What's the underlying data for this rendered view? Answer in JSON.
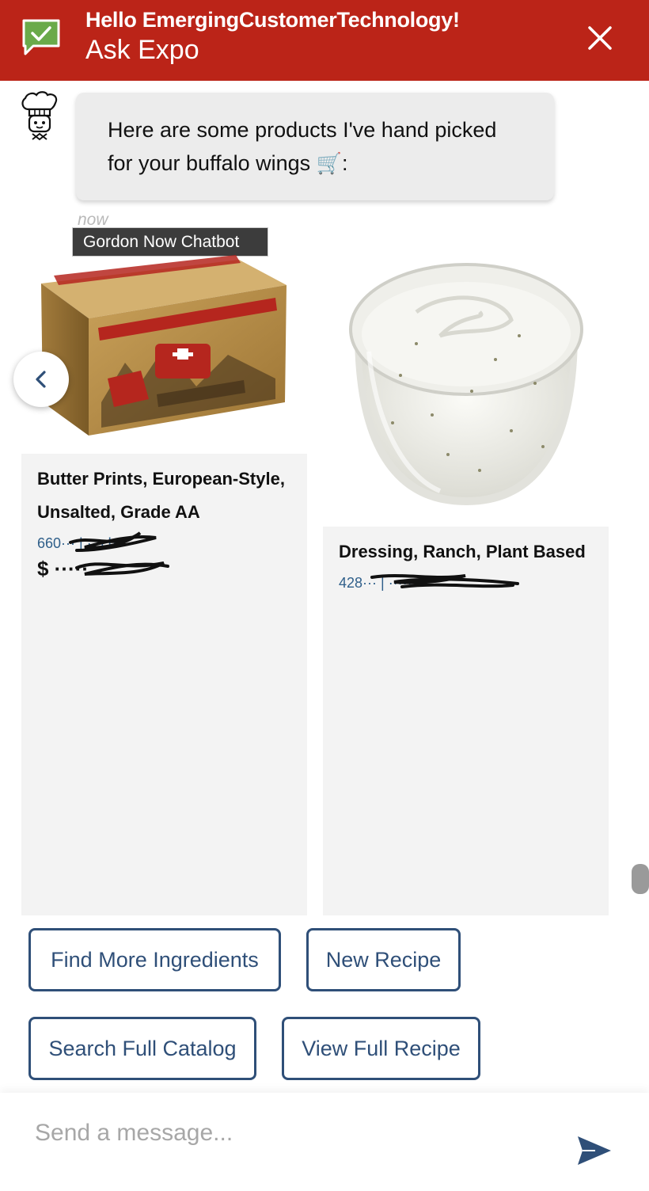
{
  "header": {
    "greeting": "Hello EmergingCustomerTechnology!",
    "title": "Ask Expo",
    "bg_color": "#bb2418"
  },
  "chat": {
    "message_text": "Here are some products I've hand picked for your buffalo wings",
    "message_emoji": "🛒",
    "message_suffix": ":",
    "timestamp": "now",
    "tooltip": "Gordon Now Chatbot"
  },
  "products": [
    {
      "name": "Butter Prints, European-Style, Unsalted, Grade AA",
      "meta": "660··· | ···ch",
      "price": "$ ·····",
      "image_icon": "butter-package-image"
    },
    {
      "name": "Dressing, Ranch, Plant Based",
      "meta": "428··· | ·····",
      "image_icon": "ranch-dressing-image"
    }
  ],
  "actions": {
    "find_more": "Find More Ingredients",
    "new_recipe": "New Recipe",
    "search_catalog": "Search Full Catalog",
    "view_recipe": "View Full Recipe"
  },
  "composer": {
    "placeholder": "Send a message..."
  },
  "colors": {
    "accent": "#2f4f78",
    "link": "#2f5f8a"
  }
}
